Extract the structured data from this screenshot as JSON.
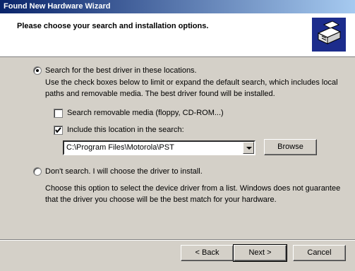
{
  "window": {
    "title": "Found New Hardware Wizard"
  },
  "header": {
    "title": "Please choose your search and installation options."
  },
  "options": {
    "search_label": "Search for the best driver in these locations.",
    "search_desc": "Use the check boxes below to limit or expand the default search, which includes local paths and removable media. The best driver found will be installed.",
    "removable_label": "Search removable media (floppy, CD-ROM...)",
    "include_label": "Include this location in the search:",
    "location_value": "C:\\Program Files\\Motorola\\PST",
    "browse_label": "Browse",
    "dont_search_label": "Don't search. I will choose the driver to install.",
    "dont_search_desc": "Choose this option to select the device driver from a list.  Windows does not guarantee that the driver you choose will be the best match for your hardware."
  },
  "buttons": {
    "back": "< Back",
    "next": "Next >",
    "cancel": "Cancel"
  }
}
